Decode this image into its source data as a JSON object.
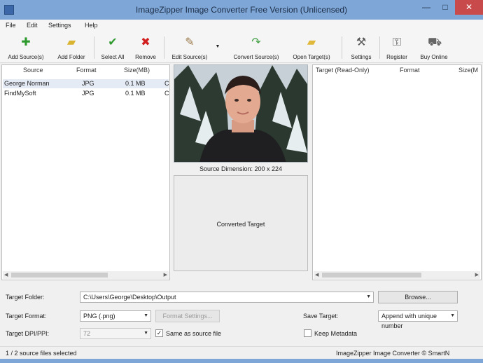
{
  "window": {
    "title": "ImageZipper Image Converter Free Version (Unlicensed)",
    "min_glyph": "—",
    "max_glyph": "□",
    "close_glyph": "✕"
  },
  "menu": [
    "File",
    "Edit",
    "Settings",
    "Help"
  ],
  "toolbar": {
    "add_sources": "Add Source(s)",
    "add_folder": "Add Folder",
    "select_all": "Select All",
    "remove": "Remove",
    "edit_sources": "Edit Source(s)",
    "convert_sources": "Convert Source(s)",
    "open_target": "Open Target(s)",
    "settings": "Settings",
    "register": "Register",
    "buy_online": "Buy Online"
  },
  "source_table": {
    "columns": [
      "Source",
      "Format",
      "Size(MB)"
    ],
    "rows": [
      {
        "source": "George Norman",
        "format": "JPG",
        "size": "0.1 MB",
        "extra": "C"
      },
      {
        "source": "FindMySoft",
        "format": "JPG",
        "size": "0.1 MB",
        "extra": "C"
      }
    ]
  },
  "preview": {
    "caption": "Source Dimension: 200 x 224",
    "converted_label": "Converted Target"
  },
  "target_table": {
    "columns": [
      "Target (Read-Only)",
      "Format",
      "Size(M"
    ]
  },
  "bottom": {
    "target_folder_label": "Target Folder:",
    "target_folder_value": "C:\\Users\\George\\Desktop\\Output",
    "browse_label": "Browse...",
    "target_format_label": "Target Format:",
    "target_format_value": "PNG (.png)",
    "format_settings_label": "Format Settings...",
    "save_target_label": "Save Target:",
    "save_target_value": "Append with unique number",
    "target_dpi_label": "Target DPI/PPI:",
    "target_dpi_value": "72",
    "same_as_source_label": "Same as source file",
    "same_as_source_checked": "✓",
    "keep_metadata_label": "Keep Metadata"
  },
  "status": {
    "left": "1 / 2 source files selected",
    "right": "ImageZipper Image Converter © SmartN"
  },
  "colors": {
    "titlebar": "#7ea6d6",
    "close": "#c94a4a",
    "accent_green": "#2e9a2e",
    "accent_red": "#d11f1f"
  }
}
